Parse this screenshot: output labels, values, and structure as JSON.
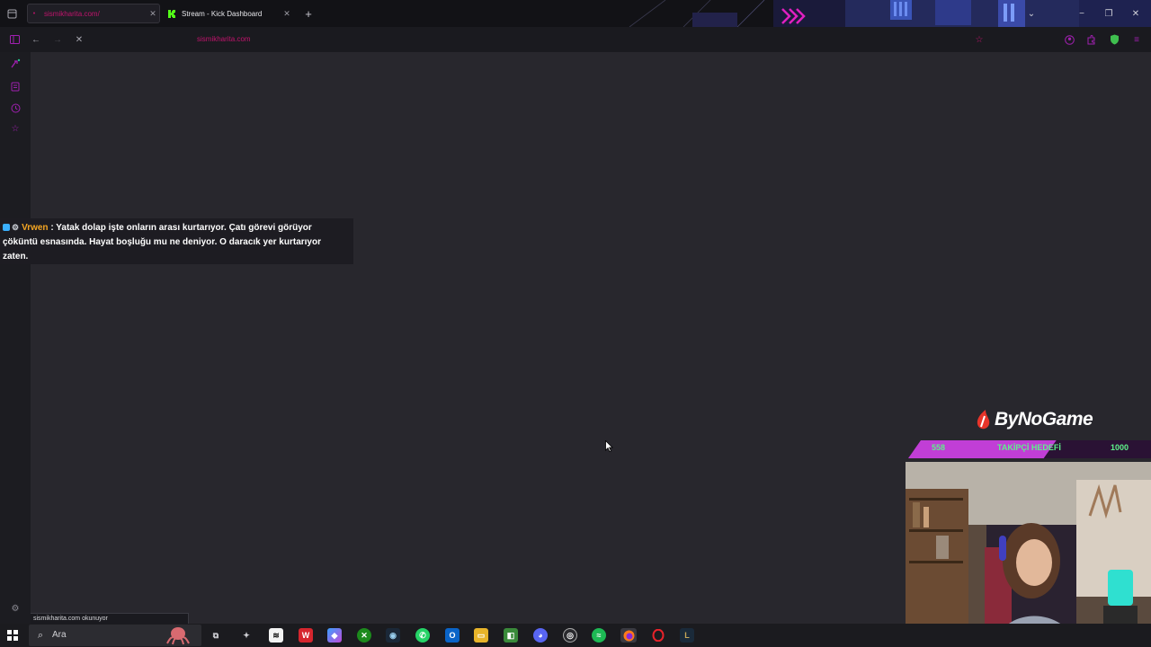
{
  "browser": {
    "tabs": [
      {
        "title": "sismikharita.com/",
        "active": true
      },
      {
        "title": "Stream - Kick Dashboard",
        "active": false
      }
    ],
    "new_tab_label": "+",
    "address": {
      "url": "sismikharita.com"
    },
    "status_text": "sismikharita.com okunuyor"
  },
  "chat_message": {
    "username": "Vrwen",
    "separator": " : ",
    "text": "Yatak dolap işte onların arası kurtarıyor. Çatı görevi görüyor çöküntü esnasında. Hayat boşluğu mu ne deniyor. O daracık yer kurtarıyor zaten."
  },
  "stream_overlay": {
    "brand": "ByNoGame",
    "goal": {
      "current": "558",
      "label": "TAKİPÇİ HEDEFİ",
      "target": "1000",
      "progress": 0.558
    }
  },
  "taskbar": {
    "search_placeholder": "Ara",
    "apps": [
      "task-view",
      "bird-app",
      "capcut",
      "wps-office",
      "copilot",
      "xbox",
      "steam",
      "whatsapp",
      "outlook",
      "file-explorer",
      "android-studio",
      "discord",
      "obs",
      "spotify",
      "firefox",
      "opera-gx",
      "league-client"
    ]
  },
  "colors": {
    "accent": "#c0146c",
    "sidebar_icon": "#a020b0",
    "goal_text": "#5ef28a",
    "goal_bar": "#c13ed6",
    "chat_user": "#f5a623"
  }
}
